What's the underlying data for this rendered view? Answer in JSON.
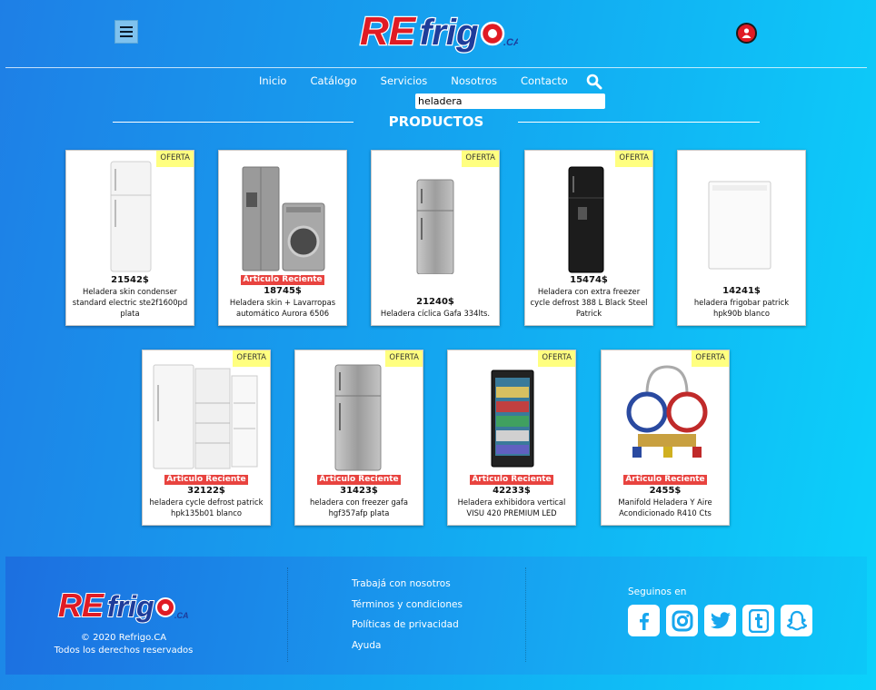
{
  "header": {
    "logo_text": "REfrigo",
    "logo_suffix": "CA"
  },
  "nav": {
    "items": [
      {
        "label": "Inicio"
      },
      {
        "label": "Catálogo"
      },
      {
        "label": "Servicios"
      },
      {
        "label": "Nosotros"
      },
      {
        "label": "Contacto"
      }
    ]
  },
  "search": {
    "value": "heladera"
  },
  "section": {
    "title": "PRODUCTOS"
  },
  "products": [
    {
      "price": "21542$",
      "name": "Heladera skin condenser standard electric ste2f1600pd plata",
      "badge": "OFERTA",
      "tag": ""
    },
    {
      "price": "18745$",
      "name": "Heladera skin + Lavarropas automático Aurora 6506",
      "badge": "",
      "tag": "Articulo Reciente"
    },
    {
      "price": "21240$",
      "name": "Heladera cíclica Gafa 334lts.",
      "badge": "OFERTA",
      "tag": ""
    },
    {
      "price": "15474$",
      "name": "Heladera con extra freezer cycle defrost 388 L Black Steel Patrick",
      "badge": "OFERTA",
      "tag": ""
    },
    {
      "price": "14241$",
      "name": "heladera frigobar patrick hpk90b blanco",
      "badge": "",
      "tag": ""
    },
    {
      "price": "32122$",
      "name": "heladera cycle defrost patrick hpk135b01 blanco",
      "badge": "OFERTA",
      "tag": "Articulo Reciente"
    },
    {
      "price": "31423$",
      "name": "heladera con freezer gafa hgf357afp plata",
      "badge": "OFERTA",
      "tag": "Articulo Reciente"
    },
    {
      "price": "42233$",
      "name": "Heladera exhibidora vertical VISU 420 PREMIUM LED",
      "badge": "OFERTA",
      "tag": "Articulo Reciente"
    },
    {
      "price": "2455$",
      "name": "Manifold Heladera Y Aire Acondicionado R410 Cts",
      "badge": "OFERTA",
      "tag": "Articulo Reciente"
    }
  ],
  "footer": {
    "copyright": "© 2020 Refrigo.CA",
    "rights": "Todos los derechos reservados",
    "links": [
      {
        "label": "Trabajá con nosotros"
      },
      {
        "label": "Términos y condiciones"
      },
      {
        "label": "Políticas de privacidad"
      },
      {
        "label": "Ayuda"
      }
    ],
    "follow_label": "Seguinos en",
    "socials": [
      "facebook-icon",
      "instagram-icon",
      "twitter-icon",
      "tumblr-icon",
      "snapchat-icon"
    ]
  },
  "colors": {
    "brand_red": "#e01b24",
    "brand_blue": "#1e3c9a",
    "oferta_bg": "#ffff80",
    "reciente_bg": "#e8433f"
  }
}
